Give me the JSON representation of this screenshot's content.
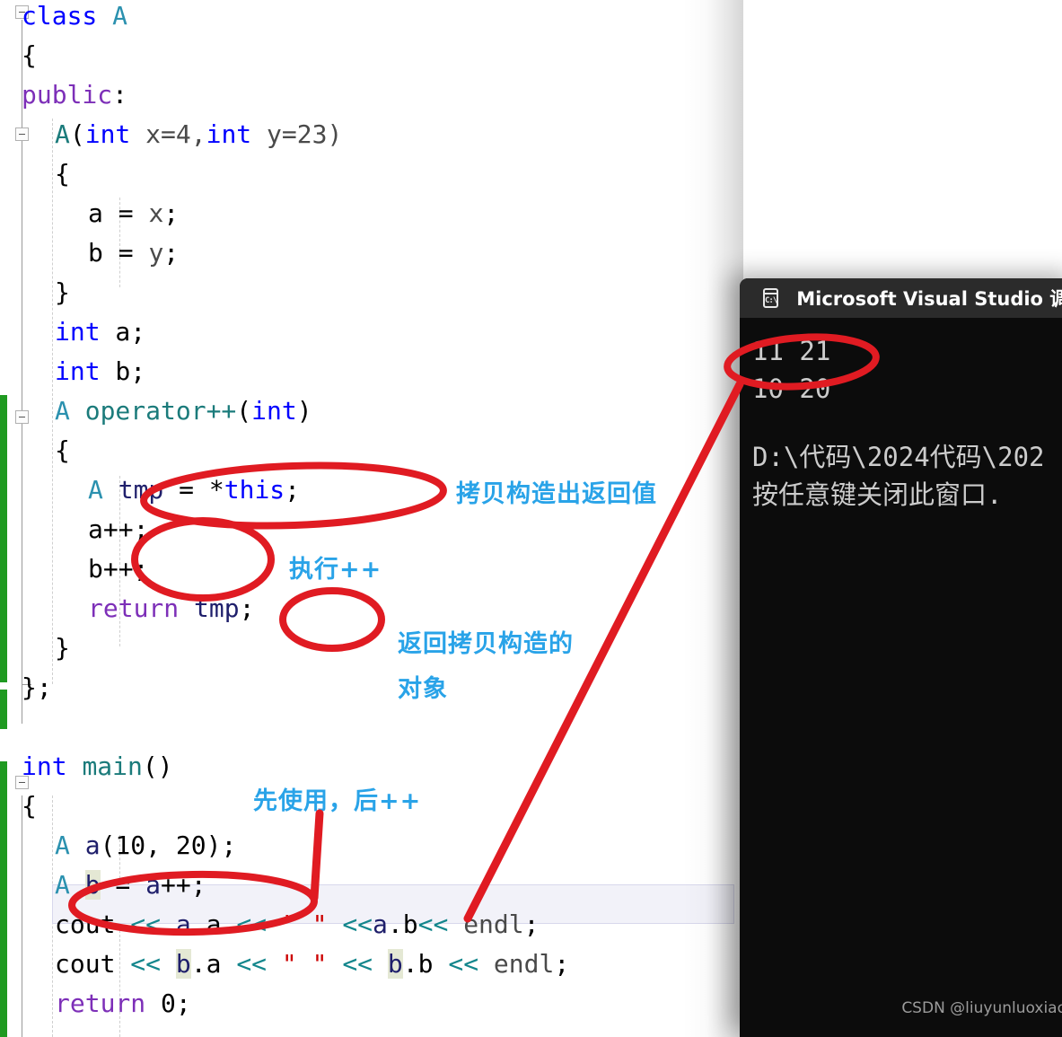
{
  "editor": {
    "code_lines": [
      {
        "indent": 0,
        "tokens": [
          {
            "t": "class",
            "c": "kw"
          },
          {
            "t": " ",
            "c": "plain"
          },
          {
            "t": "A",
            "c": "typ"
          }
        ]
      },
      {
        "indent": 0,
        "tokens": [
          {
            "t": "{",
            "c": "plain"
          }
        ]
      },
      {
        "indent": 0,
        "tokens": [
          {
            "t": "public",
            "c": "kw2"
          },
          {
            "t": ":",
            "c": "plain"
          }
        ]
      },
      {
        "indent": 1,
        "tokens": [
          {
            "t": "A",
            "c": "fn"
          },
          {
            "t": "(",
            "c": "plain"
          },
          {
            "t": "int",
            "c": "kw"
          },
          {
            "t": " x=4,",
            "c": "gray"
          },
          {
            "t": "int",
            "c": "kw"
          },
          {
            "t": " y=23)",
            "c": "gray"
          }
        ]
      },
      {
        "indent": 1,
        "tokens": [
          {
            "t": "{",
            "c": "plain"
          }
        ]
      },
      {
        "indent": 2,
        "tokens": [
          {
            "t": "a = ",
            "c": "plain"
          },
          {
            "t": "x",
            "c": "gray"
          },
          {
            "t": ";",
            "c": "plain"
          }
        ]
      },
      {
        "indent": 2,
        "tokens": [
          {
            "t": "b = ",
            "c": "plain"
          },
          {
            "t": "y",
            "c": "gray"
          },
          {
            "t": ";",
            "c": "plain"
          }
        ]
      },
      {
        "indent": 1,
        "tokens": [
          {
            "t": "}",
            "c": "plain"
          }
        ]
      },
      {
        "indent": 1,
        "tokens": [
          {
            "t": "int",
            "c": "kw"
          },
          {
            "t": " a;",
            "c": "plain"
          }
        ]
      },
      {
        "indent": 1,
        "tokens": [
          {
            "t": "int",
            "c": "kw"
          },
          {
            "t": " b;",
            "c": "plain"
          }
        ]
      },
      {
        "indent": 1,
        "tokens": [
          {
            "t": "A",
            "c": "typ"
          },
          {
            "t": " ",
            "c": "plain"
          },
          {
            "t": "operator++",
            "c": "fn"
          },
          {
            "t": "(",
            "c": "plain"
          },
          {
            "t": "int",
            "c": "kw"
          },
          {
            "t": ")",
            "c": "plain"
          }
        ]
      },
      {
        "indent": 1,
        "tokens": [
          {
            "t": "{",
            "c": "plain"
          }
        ]
      },
      {
        "indent": 2,
        "tokens": [
          {
            "t": "A",
            "c": "typ"
          },
          {
            "t": " ",
            "c": "plain"
          },
          {
            "t": "tmp",
            "c": "id"
          },
          {
            "t": " = *",
            "c": "plain"
          },
          {
            "t": "this",
            "c": "kw"
          },
          {
            "t": ";",
            "c": "plain"
          }
        ]
      },
      {
        "indent": 2,
        "tokens": [
          {
            "t": "a++;",
            "c": "plain"
          }
        ]
      },
      {
        "indent": 2,
        "tokens": [
          {
            "t": "b++;",
            "c": "plain"
          }
        ]
      },
      {
        "indent": 2,
        "tokens": [
          {
            "t": "return",
            "c": "kw2"
          },
          {
            "t": " ",
            "c": "plain"
          },
          {
            "t": "tmp",
            "c": "id"
          },
          {
            "t": ";",
            "c": "plain"
          }
        ]
      },
      {
        "indent": 1,
        "tokens": [
          {
            "t": "}",
            "c": "plain"
          }
        ]
      },
      {
        "indent": 0,
        "tokens": [
          {
            "t": "};",
            "c": "plain"
          }
        ]
      },
      {
        "indent": 0,
        "tokens": []
      },
      {
        "indent": 0,
        "tokens": [
          {
            "t": "int",
            "c": "kw"
          },
          {
            "t": " ",
            "c": "plain"
          },
          {
            "t": "main",
            "c": "fn"
          },
          {
            "t": "()",
            "c": "plain"
          }
        ]
      },
      {
        "indent": 0,
        "tokens": [
          {
            "t": "{",
            "c": "plain"
          }
        ]
      },
      {
        "indent": 1,
        "tokens": [
          {
            "t": "A",
            "c": "typ"
          },
          {
            "t": " ",
            "c": "plain"
          },
          {
            "t": "a",
            "c": "id"
          },
          {
            "t": "(10, 20);",
            "c": "plain"
          }
        ]
      },
      {
        "indent": 1,
        "tokens": [
          {
            "t": "A",
            "c": "typ"
          },
          {
            "t": " ",
            "c": "plain"
          },
          {
            "t": "b",
            "c": "id hl"
          },
          {
            "t": " = ",
            "c": "plain"
          },
          {
            "t": "a",
            "c": "id"
          },
          {
            "t": "++;",
            "c": "plain"
          }
        ]
      },
      {
        "indent": 1,
        "tokens": [
          {
            "t": "cout ",
            "c": "plain"
          },
          {
            "t": "<<",
            "c": "op"
          },
          {
            "t": " ",
            "c": "plain"
          },
          {
            "t": "a",
            "c": "id"
          },
          {
            "t": ".a ",
            "c": "plain"
          },
          {
            "t": "<<",
            "c": "op"
          },
          {
            "t": " ",
            "c": "plain"
          },
          {
            "t": "\" \"",
            "c": "str"
          },
          {
            "t": " ",
            "c": "plain"
          },
          {
            "t": "<<",
            "c": "op"
          },
          {
            "t": "a",
            "c": "id"
          },
          {
            "t": ".b",
            "c": "plain"
          },
          {
            "t": "<<",
            "c": "op"
          },
          {
            "t": " ",
            "c": "plain"
          },
          {
            "t": "endl",
            "c": "gray"
          },
          {
            "t": ";",
            "c": "plain"
          }
        ]
      },
      {
        "indent": 1,
        "tokens": [
          {
            "t": "cout ",
            "c": "plain"
          },
          {
            "t": "<<",
            "c": "op"
          },
          {
            "t": " ",
            "c": "plain"
          },
          {
            "t": "b",
            "c": "id hl"
          },
          {
            "t": ".a ",
            "c": "plain"
          },
          {
            "t": "<<",
            "c": "op"
          },
          {
            "t": " ",
            "c": "plain"
          },
          {
            "t": "\" \"",
            "c": "str"
          },
          {
            "t": " ",
            "c": "plain"
          },
          {
            "t": "<<",
            "c": "op"
          },
          {
            "t": " ",
            "c": "plain"
          },
          {
            "t": "b",
            "c": "id hl"
          },
          {
            "t": ".b ",
            "c": "plain"
          },
          {
            "t": "<<",
            "c": "op"
          },
          {
            "t": " ",
            "c": "plain"
          },
          {
            "t": "endl",
            "c": "gray"
          },
          {
            "t": ";",
            "c": "plain"
          }
        ]
      },
      {
        "indent": 1,
        "tokens": [
          {
            "t": "return",
            "c": "kw2"
          },
          {
            "t": " 0;",
            "c": "plain"
          }
        ]
      }
    ]
  },
  "console": {
    "title": "Microsoft Visual Studio 调试",
    "icon": "console-cmd-icon",
    "output_lines": [
      "11 21",
      "10 20",
      "",
      "D:\\代码\\2024代码\\202",
      "按任意键关闭此窗口."
    ],
    "watermark": "CSDN @liuyunluoxiao"
  },
  "annotations": [
    {
      "id": "anno-copy-ctor-return",
      "text": "拷贝构造出返回值"
    },
    {
      "id": "anno-do-increment",
      "text": "执行++"
    },
    {
      "id": "anno-return-copy-1",
      "text": "返回拷贝构造的"
    },
    {
      "id": "anno-return-copy-2",
      "text": "对象"
    },
    {
      "id": "anno-use-first",
      "text": "先使用，后++"
    }
  ],
  "colors": {
    "annotation_blue": "#29a3e8",
    "markup_red": "#e01b22",
    "keyword_blue": "#0000ff",
    "type_teal": "#2b91af",
    "string_red": "#cc0000",
    "changebar_green": "#1f9a21",
    "console_bg": "#0c0c0c",
    "console_titlebar": "#2b2b2b"
  }
}
